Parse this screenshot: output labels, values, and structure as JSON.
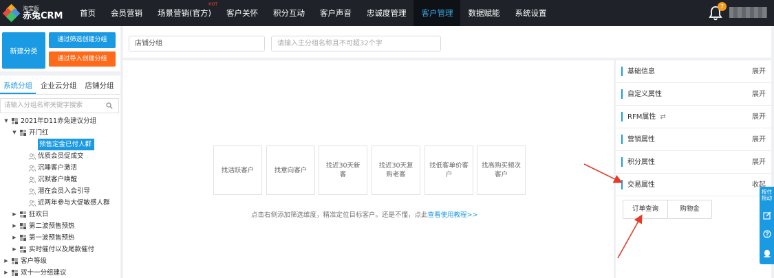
{
  "nav": {
    "logo_top": "淘宝版",
    "logo_main": "赤兔CRM",
    "items": [
      "首页",
      "会员营销",
      "场景营销(官方)",
      "客户关怀",
      "积分互动",
      "客户声音",
      "忠诚度管理",
      "客户管理",
      "数据赋能",
      "系统设置"
    ],
    "hot_label": "HOT",
    "active_index": 7,
    "notification_count": "7"
  },
  "left": {
    "new_category": "新建分类",
    "filter_create": "通过筛选创建分组",
    "import_create": "通过导入创建分组",
    "tabs": [
      "系统分组",
      "企业云分组",
      "店铺分组"
    ],
    "active_tab": 0,
    "search_placeholder": "请输入分组名称关键字搜索",
    "tree": [
      {
        "label": "2021年D11赤兔建议分组",
        "level": 0,
        "caret": "▼",
        "icon": "group"
      },
      {
        "label": "开门红",
        "level": 1,
        "caret": "▼",
        "icon": "group"
      },
      {
        "label": "预售定金已付人群",
        "level": 2,
        "caret": "",
        "icon": "person",
        "selected": true
      },
      {
        "label": "优质会员促成交",
        "level": 2,
        "caret": "",
        "icon": "person"
      },
      {
        "label": "沉睡客户激活",
        "level": 2,
        "caret": "",
        "icon": "person"
      },
      {
        "label": "沉默客户唤醒",
        "level": 2,
        "caret": "",
        "icon": "person"
      },
      {
        "label": "潜在会员入会引导",
        "level": 2,
        "caret": "",
        "icon": "person"
      },
      {
        "label": "近两年参与大促敏感人群",
        "level": 2,
        "caret": "",
        "icon": "person"
      },
      {
        "label": "狂欢日",
        "level": 1,
        "caret": "▶",
        "icon": "group"
      },
      {
        "label": "第二波预售预热",
        "level": 1,
        "caret": "▶",
        "icon": "group"
      },
      {
        "label": "第一波预售预热",
        "level": 1,
        "caret": "▶",
        "icon": "group"
      },
      {
        "label": "实时催付以及尾款催付",
        "level": 1,
        "caret": "▶",
        "icon": "group"
      },
      {
        "label": "客户等级",
        "level": 0,
        "caret": "▶",
        "icon": "group"
      },
      {
        "label": "双十一分组建议",
        "level": 0,
        "caret": "▶",
        "icon": "group"
      }
    ]
  },
  "toolbar": {
    "group_select": "店铺分组",
    "name_placeholder": "请输入主分组名称且不可超32个字"
  },
  "canvas": {
    "quick_cards": [
      "找活跃客户",
      "找意向客户",
      "找近30天新客",
      "找近30天复购老客",
      "找低客单价客户",
      "找高购买频次客户"
    ],
    "hint_text": "点击右侧添加筛选维度，精准定位目标客户。还是不懂，点此",
    "hint_link": "查看使用教程>>"
  },
  "right": {
    "sections": [
      {
        "label": "基础信息",
        "toggle": "展开"
      },
      {
        "label": "自定义属性",
        "toggle": "展开"
      },
      {
        "label": "RFM属性",
        "toggle": "展开",
        "swap": "⇄"
      },
      {
        "label": "营销属性",
        "toggle": "展开"
      },
      {
        "label": "积分属性",
        "toggle": "展开"
      },
      {
        "label": "交易属性",
        "toggle": "收起"
      }
    ],
    "buttons": [
      "订单查询",
      "购物金"
    ]
  },
  "float": {
    "label": "按住拖动"
  },
  "colors": {
    "accent": "#1b9ae4",
    "orange": "#ff6a1a",
    "nav_bg": "#1f2329",
    "arrow": "#e53a2a"
  }
}
